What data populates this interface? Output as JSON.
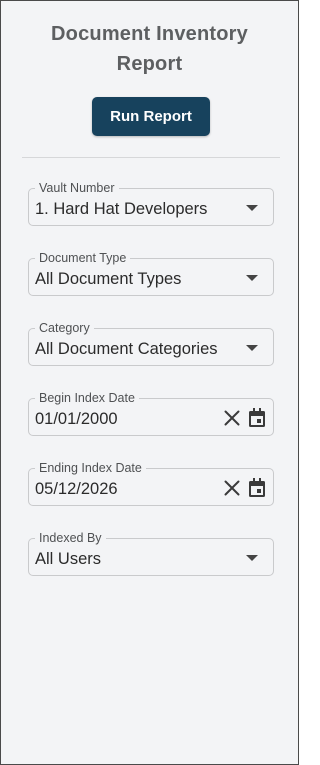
{
  "header": {
    "title_line1": "Document Inventory",
    "title_line2": "Report",
    "run_button_label": "Run Report"
  },
  "fields": {
    "vault": {
      "label": "Vault Number",
      "value": "1. Hard Hat Developers",
      "icon": "chevron-down-icon"
    },
    "document_type": {
      "label": "Document Type",
      "value": "All Document Types",
      "icon": "chevron-down-icon"
    },
    "category": {
      "label": "Category",
      "value": "All Document Categories",
      "icon": "chevron-down-icon"
    },
    "begin_index_date": {
      "label": "Begin Index Date",
      "value": "01/01/2000",
      "icons": [
        "close-icon",
        "calendar-icon"
      ]
    },
    "ending_index_date": {
      "label": "Ending Index Date",
      "value": "05/12/2026",
      "icons": [
        "close-icon",
        "calendar-icon"
      ]
    },
    "indexed_by": {
      "label": "Indexed By",
      "value": "All Users",
      "icon": "chevron-down-icon"
    }
  },
  "colors": {
    "panel_background": "#f3f4f6",
    "button_background": "#17425d",
    "title_text": "#5d5f61",
    "field_border": "#c9cacc"
  }
}
